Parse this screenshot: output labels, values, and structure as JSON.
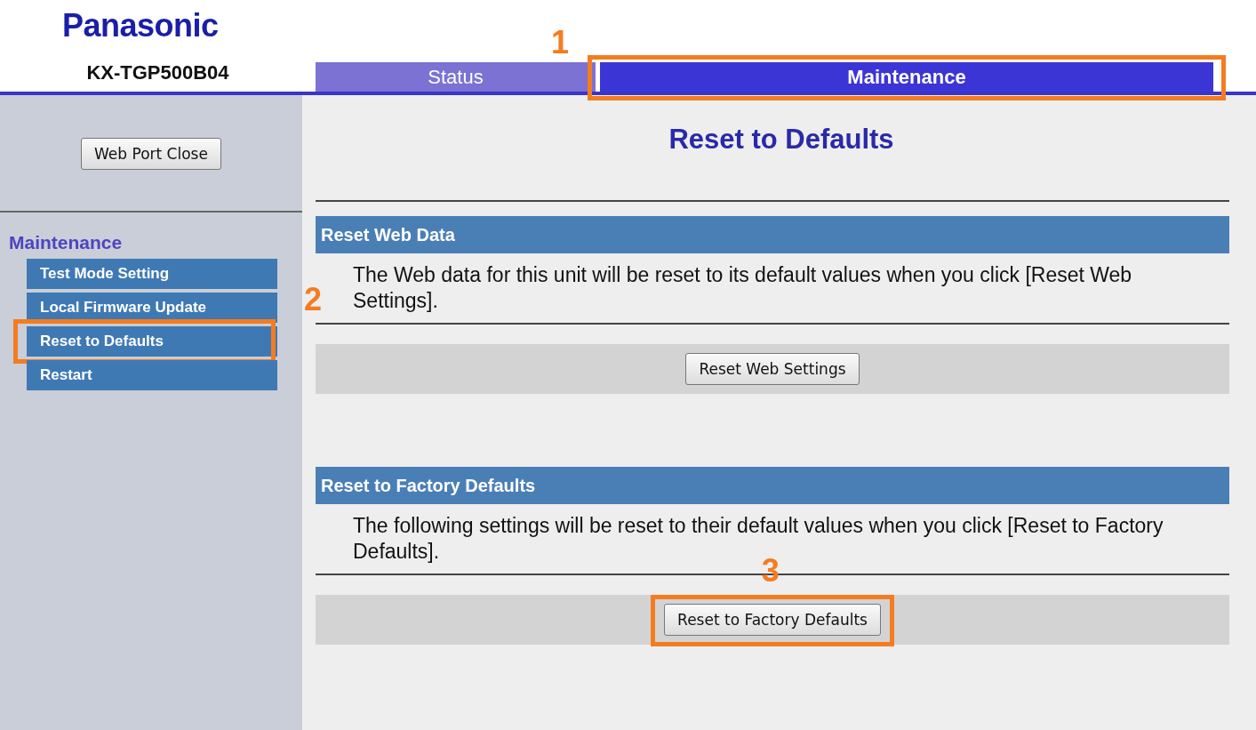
{
  "header": {
    "logo": "Panasonic",
    "model": "KX-TGP500B04"
  },
  "tabs": [
    {
      "label": "Status",
      "selected": false
    },
    {
      "label": "Maintenance",
      "selected": true,
      "callout": "1"
    }
  ],
  "sidebar": {
    "close_button": "Web Port Close",
    "heading": "Maintenance",
    "items": [
      {
        "label": "Test Mode Setting"
      },
      {
        "label": "Local Firmware Update"
      },
      {
        "label": "Reset to Defaults",
        "callout": "2"
      },
      {
        "label": "Restart"
      }
    ]
  },
  "page_title": "Reset to Defaults",
  "sections": [
    {
      "title": "Reset Web Data",
      "description": "The Web data for this unit will be reset to its default values when you click [Reset Web Settings].",
      "button": "Reset Web Settings"
    },
    {
      "title": "Reset to Factory Defaults",
      "description": "The following settings will be reset to their default values when you click [Reset to Factory Defaults].",
      "button": "Reset to Factory Defaults",
      "callout": "3"
    }
  ]
}
